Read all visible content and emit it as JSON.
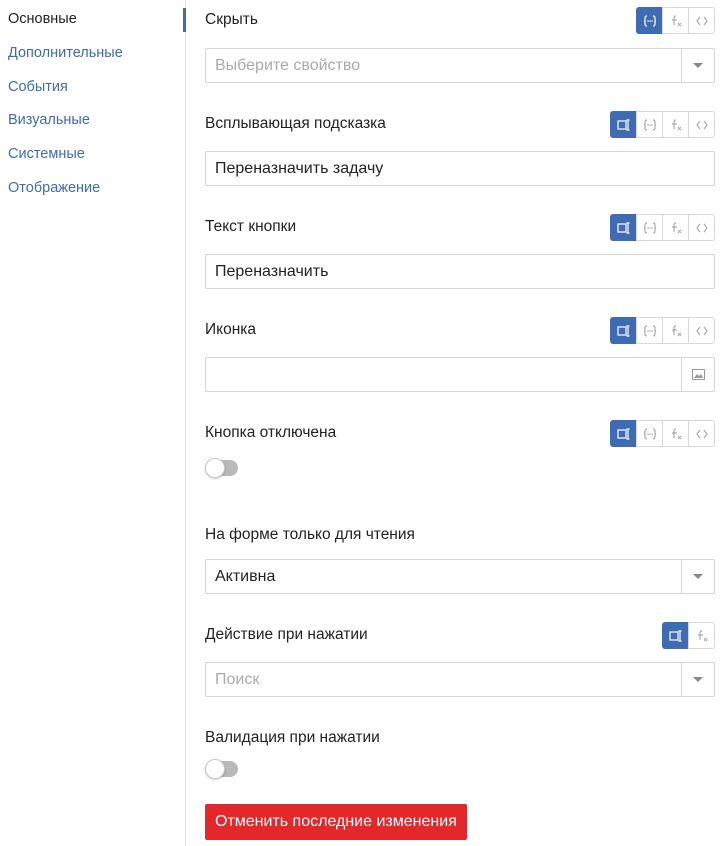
{
  "sidebar": {
    "items": [
      {
        "label": "Основные"
      },
      {
        "label": "Дополнительные"
      },
      {
        "label": "События"
      },
      {
        "label": "Визуальные"
      },
      {
        "label": "Системные"
      },
      {
        "label": "Отображение"
      }
    ]
  },
  "form": {
    "hide": {
      "label": "Скрыть",
      "placeholder": "Выберите свойство"
    },
    "tooltip": {
      "label": "Всплывающая подсказка",
      "value": "Переназначить задачу"
    },
    "button_text": {
      "label": "Текст кнопки",
      "value": "Переназначить"
    },
    "icon": {
      "label": "Иконка",
      "value": ""
    },
    "disabled": {
      "label": "Кнопка отключена",
      "on": false
    },
    "readonly": {
      "label": "На форме только для чтения",
      "value": "Активна"
    },
    "on_click": {
      "label": "Действие при нажатии",
      "placeholder": "Поиск"
    },
    "validation": {
      "label": "Валидация при нажатии",
      "on": false
    }
  },
  "actions": {
    "revert_label": "Отменить последние изменения"
  },
  "colors": {
    "accent": "#3f6bb3",
    "danger": "#e5262b",
    "border": "#d6d6d6"
  }
}
